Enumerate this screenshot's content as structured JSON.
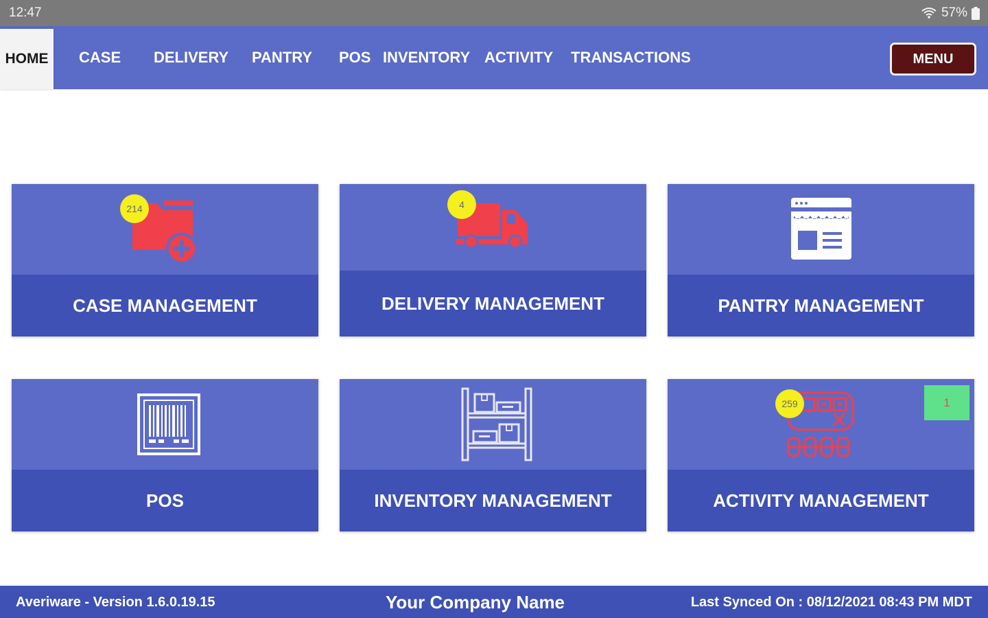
{
  "status_bar": {
    "time": "12:47",
    "battery": "57%",
    "icons": [
      "wifi-icon",
      "battery-icon"
    ]
  },
  "nav": {
    "home": "HOME",
    "tabs": [
      "CASE",
      "DELIVERY",
      "PANTRY",
      "POS",
      "INVENTORY",
      "ACTIVITY",
      "TRANSACTIONS"
    ],
    "menu_label": "MENU"
  },
  "tiles": [
    {
      "label": "CASE MANAGEMENT",
      "icon": "folder-add-icon",
      "badge": "214"
    },
    {
      "label": "DELIVERY MANAGEMENT",
      "icon": "delivery-truck-icon",
      "badge": "4"
    },
    {
      "label": "PANTRY MANAGEMENT",
      "icon": "storefront-icon"
    },
    {
      "label": "POS",
      "icon": "barcode-icon"
    },
    {
      "label": "INVENTORY MANAGEMENT",
      "icon": "warehouse-shelves-icon"
    },
    {
      "label": "ACTIVITY MANAGEMENT",
      "icon": "activity-calendar-icon",
      "badge": "259",
      "extra_badge": "1"
    }
  ],
  "footer": {
    "version": "Averiware - Version 1.6.0.19.15",
    "company": "Your Company Name",
    "last_synced": "Last Synced On : 08/12/2021 08:43 PM MDT"
  },
  "colors": {
    "status_bar": "#7a7a7a",
    "nav_bar": "#5b6bc8",
    "tile": "#5c6bc8",
    "tile_band": "#3f51b5",
    "menu_button": "#5a1212",
    "icon_red": "#f0404a",
    "badge_yellow": "#f5ef1e",
    "badge_green": "#5fe08a"
  }
}
